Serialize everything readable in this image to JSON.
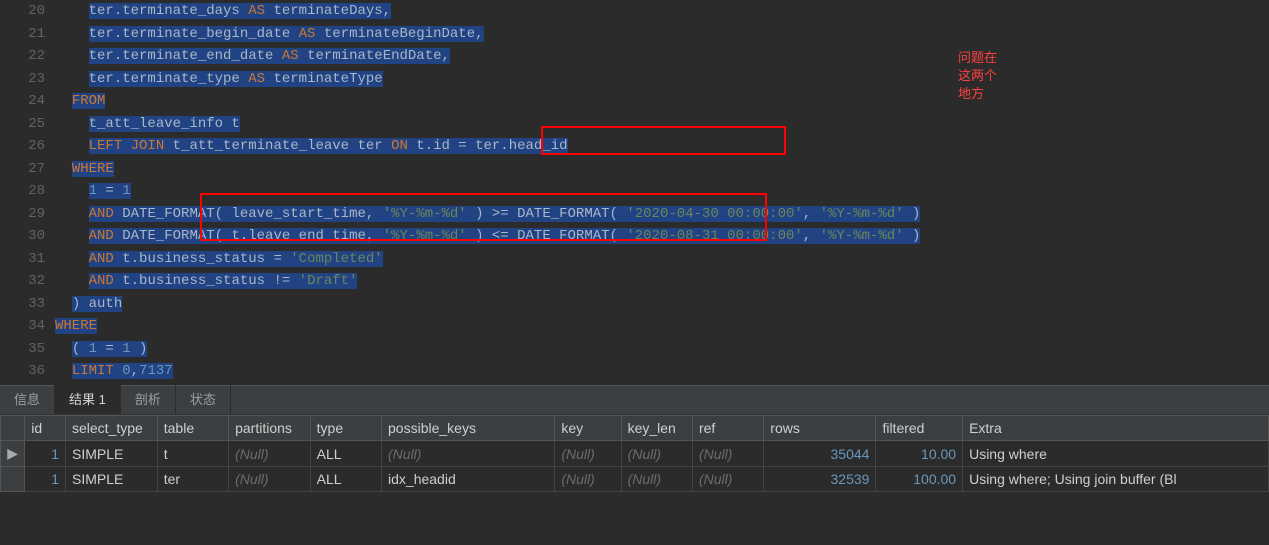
{
  "editor": {
    "lines": [
      {
        "n": 20,
        "tokens": [
          [
            "    ",
            "id"
          ],
          [
            "ter.terminate_days",
            "id sel"
          ],
          [
            " ",
            "sel"
          ],
          [
            "AS",
            "kw sel"
          ],
          [
            " ",
            "sel"
          ],
          [
            "terminateDays,",
            "id sel"
          ]
        ]
      },
      {
        "n": 21,
        "tokens": [
          [
            "    ",
            "id"
          ],
          [
            "ter.terminate_begin_date",
            "id sel"
          ],
          [
            " ",
            "sel"
          ],
          [
            "AS",
            "kw sel"
          ],
          [
            " ",
            "sel"
          ],
          [
            "terminateBeginDate,",
            "id sel"
          ]
        ]
      },
      {
        "n": 22,
        "tokens": [
          [
            "    ",
            "id"
          ],
          [
            "ter.terminate_end_date",
            "id sel"
          ],
          [
            " ",
            "sel"
          ],
          [
            "AS",
            "kw sel"
          ],
          [
            " ",
            "sel"
          ],
          [
            "terminateEndDate,",
            "id sel"
          ]
        ]
      },
      {
        "n": 23,
        "tokens": [
          [
            "    ",
            "id"
          ],
          [
            "ter.terminate_type",
            "id sel"
          ],
          [
            " ",
            "sel"
          ],
          [
            "AS",
            "kw sel"
          ],
          [
            " ",
            "sel"
          ],
          [
            "terminateType",
            "id sel"
          ]
        ]
      },
      {
        "n": 24,
        "tokens": [
          [
            "  ",
            "id"
          ],
          [
            "FROM",
            "kw sel"
          ]
        ]
      },
      {
        "n": 25,
        "tokens": [
          [
            "    ",
            "id"
          ],
          [
            "t_att_leave_info t",
            "id sel"
          ]
        ]
      },
      {
        "n": 26,
        "tokens": [
          [
            "    ",
            "id"
          ],
          [
            "LEFT",
            "kw sel"
          ],
          [
            " ",
            "sel"
          ],
          [
            "JOIN",
            "kw sel"
          ],
          [
            " ",
            "sel"
          ],
          [
            "t_att_terminate_leave ter ",
            "id sel"
          ],
          [
            "ON",
            "kw sel"
          ],
          [
            " ",
            "sel"
          ],
          [
            "t.id = ter.head_id",
            "id sel"
          ]
        ]
      },
      {
        "n": 27,
        "tokens": [
          [
            "  ",
            "id"
          ],
          [
            "WHERE",
            "kw sel"
          ]
        ]
      },
      {
        "n": 28,
        "tokens": [
          [
            "    ",
            "id"
          ],
          [
            "1",
            "num sel"
          ],
          [
            " = ",
            "op sel"
          ],
          [
            "1",
            "num sel"
          ]
        ]
      },
      {
        "n": 29,
        "tokens": [
          [
            "    ",
            "id"
          ],
          [
            "AND",
            "kw sel"
          ],
          [
            " ",
            "sel"
          ],
          [
            "DATE_FORMAT( leave_start_time, ",
            "id sel"
          ],
          [
            "'%Y-%m-%d'",
            "str sel"
          ],
          [
            " ) >= DATE_FORMAT",
            "id sel"
          ],
          [
            "( ",
            "id sel"
          ],
          [
            "'2020-04-30 00:00:00'",
            "str sel"
          ],
          [
            ", ",
            "id sel"
          ],
          [
            "'%Y-%m-%d'",
            "str sel"
          ],
          [
            " )",
            "id sel"
          ]
        ]
      },
      {
        "n": 30,
        "tokens": [
          [
            "    ",
            "id"
          ],
          [
            "AND",
            "kw sel"
          ],
          [
            " ",
            "sel"
          ],
          [
            "DATE_FORMAT( t.leave_end_time, ",
            "id sel"
          ],
          [
            "'%Y-%m-%d'",
            "str sel"
          ],
          [
            " ) <= DATE_FORMAT",
            "id sel"
          ],
          [
            "( ",
            "id sel"
          ],
          [
            "'2020-08-31 00:00:00'",
            "str sel"
          ],
          [
            ", ",
            "id sel"
          ],
          [
            "'%Y-%m-%d'",
            "str sel"
          ],
          [
            " )",
            "id sel"
          ]
        ]
      },
      {
        "n": 31,
        "tokens": [
          [
            "    ",
            "id"
          ],
          [
            "AND",
            "kw sel"
          ],
          [
            " ",
            "sel"
          ],
          [
            "t.business_status = ",
            "id sel"
          ],
          [
            "'Completed'",
            "str sel"
          ]
        ]
      },
      {
        "n": 32,
        "tokens": [
          [
            "    ",
            "id"
          ],
          [
            "AND",
            "kw sel"
          ],
          [
            " ",
            "sel"
          ],
          [
            "t.business_status != ",
            "id sel"
          ],
          [
            "'Draft'",
            "str sel"
          ]
        ]
      },
      {
        "n": 33,
        "tokens": [
          [
            "  ",
            "id"
          ],
          [
            ") auth",
            "id sel"
          ]
        ]
      },
      {
        "n": 34,
        "tokens": [
          [
            "WHERE",
            "kw sel"
          ]
        ]
      },
      {
        "n": 35,
        "tokens": [
          [
            "  ",
            "id"
          ],
          [
            "( ",
            "id sel"
          ],
          [
            "1",
            "num sel"
          ],
          [
            " = ",
            "op sel"
          ],
          [
            "1",
            "num sel"
          ],
          [
            " )",
            "id sel"
          ]
        ]
      },
      {
        "n": 36,
        "tokens": [
          [
            "  ",
            "id"
          ],
          [
            "LIMIT",
            "kw sel"
          ],
          [
            " ",
            "sel"
          ],
          [
            "0",
            "num sel"
          ],
          [
            ",",
            "id sel"
          ],
          [
            "7137",
            "num sel"
          ]
        ]
      }
    ]
  },
  "annotation": {
    "l1": "问题在",
    "l2": "这两个",
    "l3": "地方"
  },
  "tabs": {
    "t0": "信息",
    "t1": "结果 1",
    "t2": "剖析",
    "t3": "状态"
  },
  "results": {
    "headers": [
      "id",
      "select_type",
      "table",
      "partitions",
      "type",
      "possible_keys",
      "key",
      "key_len",
      "ref",
      "rows",
      "filtered",
      "Extra"
    ],
    "rows": [
      {
        "marker": "▶",
        "id": "1",
        "select_type": "SIMPLE",
        "table": "t",
        "partitions": "(Null)",
        "type": "ALL",
        "possible_keys": "(Null)",
        "key": "(Null)",
        "key_len": "(Null)",
        "ref": "(Null)",
        "rows": "35044",
        "filtered": "10.00",
        "Extra": "Using where"
      },
      {
        "marker": "",
        "id": "1",
        "select_type": "SIMPLE",
        "table": "ter",
        "partitions": "(Null)",
        "type": "ALL",
        "possible_keys": "idx_headid",
        "key": "(Null)",
        "key_len": "(Null)",
        "ref": "(Null)",
        "rows": "32539",
        "filtered": "100.00",
        "Extra": "Using where; Using join buffer (Bl"
      }
    ]
  }
}
